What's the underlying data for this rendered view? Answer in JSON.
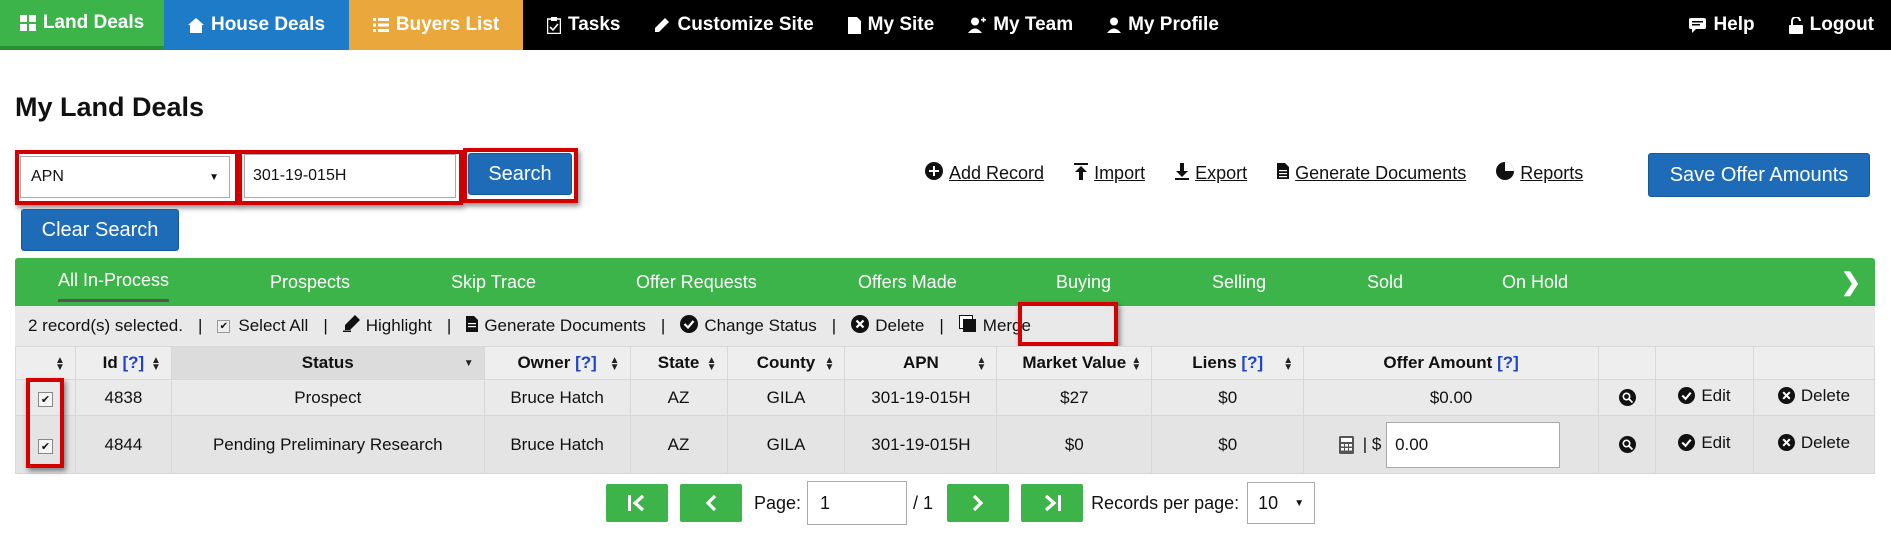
{
  "nav": {
    "land": "Land Deals",
    "house": "House Deals",
    "buyers": "Buyers List",
    "tasks": "Tasks",
    "customize": "Customize Site",
    "mysite": "My Site",
    "myteam": "My Team",
    "myprofile": "My Profile",
    "help": "Help",
    "logout": "Logout"
  },
  "page_title": "My Land Deals",
  "search": {
    "field_selected": "APN",
    "value": "301-19-015H",
    "search_label": "Search",
    "clear_label": "Clear Search"
  },
  "toolbar": {
    "add_record": "Add Record",
    "import": "Import",
    "export": "Export",
    "generate_documents": "Generate Documents",
    "reports": "Reports",
    "save_offer_amounts": "Save Offer Amounts"
  },
  "tabs": [
    "All In-Process",
    "Prospects",
    "Skip Trace",
    "Offer Requests",
    "Offers Made",
    "Buying",
    "Selling",
    "Sold",
    "On Hold"
  ],
  "tab_arrow": "❯",
  "actions": {
    "selected_count": "2 record(s) selected.",
    "select_all": "Select All",
    "highlight": "Highlight",
    "generate_documents": "Generate Documents",
    "change_status": "Change Status",
    "delete": "Delete",
    "merge": "Merge"
  },
  "table": {
    "headers": {
      "id": "Id",
      "status": "Status",
      "owner": "Owner",
      "state": "State",
      "county": "County",
      "apn": "APN",
      "market_value": "Market Value",
      "liens": "Liens",
      "offer_amount": "Offer Amount",
      "help": "[?]"
    },
    "rows": [
      {
        "id": "4838",
        "status": "Prospect",
        "owner": "Bruce Hatch",
        "state": "AZ",
        "county": "GILA",
        "apn": "301-19-015H",
        "market_value": "$27",
        "liens": "$0",
        "offer": "$0.00",
        "edit": "Edit",
        "delete": "Delete"
      },
      {
        "id": "4844",
        "status": "Pending Preliminary Research",
        "owner": "Bruce Hatch",
        "state": "AZ",
        "county": "GILA",
        "apn": "301-19-015H",
        "market_value": "$0",
        "liens": "$0",
        "offer_prefix": "| $",
        "offer_input": "0.00",
        "edit": "Edit",
        "delete": "Delete"
      }
    ]
  },
  "pagination": {
    "page_label": "Page:",
    "page_value": "1",
    "of_total": "/ 1",
    "records_label": "Records per page:",
    "per_page": "10"
  }
}
